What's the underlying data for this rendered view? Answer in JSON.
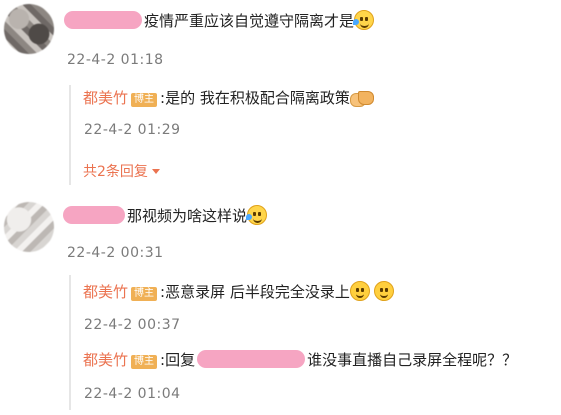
{
  "threads": [
    {
      "comment": {
        "text": "疫情严重应该自觉遵守隔离才是",
        "emoji": "laugh-cry-emoji",
        "time": "22-4-2 01:18"
      },
      "replies": [
        {
          "user": "都美竹",
          "badge": "博主",
          "text": ":是的 我在积极配合隔离政策",
          "emoji": "handshake-emoji",
          "time": "22-4-2 01:29"
        }
      ],
      "more_label": "共2条回复"
    },
    {
      "comment": {
        "text": "那视频为啥这样说",
        "emoji": "laugh-cry-emoji",
        "time": "22-4-2 00:31"
      },
      "replies": [
        {
          "user": "都美竹",
          "badge": "博主",
          "text": ":恶意录屏 后半段完全没录上",
          "emoji": "smile-emoji",
          "time": "22-4-2 00:37"
        },
        {
          "user": "都美竹",
          "badge": "博主",
          "prefix": ":回复",
          "text": "谁没事直播自己录屏全程呢？？",
          "time": "22-4-2 01:04"
        }
      ]
    }
  ],
  "colors": {
    "username": "#eb7350",
    "badge": "#f0b055",
    "redaction": "#f6a5c2",
    "timestamp": "#7b7b7b"
  }
}
